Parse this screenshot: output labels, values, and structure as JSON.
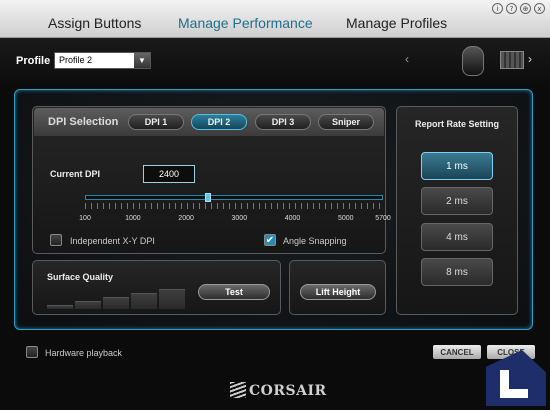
{
  "tabs": {
    "assign": "Assign Buttons",
    "manage_performance": "Manage Performance",
    "manage_profiles": "Manage Profiles"
  },
  "window_controls": [
    "i",
    "?",
    "⊕",
    "x"
  ],
  "profile": {
    "label": "Profile",
    "selected": "Profile 2"
  },
  "dpi": {
    "title": "DPI Selection",
    "buttons": [
      "DPI 1",
      "DPI 2",
      "DPI 3",
      "Sniper"
    ],
    "active_index": 1,
    "current_label": "Current DPI",
    "current_value": "2400",
    "slider_min": 100,
    "slider_max": 5700,
    "tick_labels": [
      "100",
      "1000",
      "2000",
      "3000",
      "4000",
      "5000",
      "5700"
    ],
    "independent_xy": {
      "label": "Independent X-Y DPI",
      "checked": false
    },
    "angle_snapping": {
      "label": "Angle Snapping",
      "checked": true
    }
  },
  "surface": {
    "title": "Surface Quality",
    "test_label": "Test",
    "level": 0
  },
  "lift": {
    "label": "Lift Height"
  },
  "report_rate": {
    "title": "Report Rate Setting",
    "options": [
      "1 ms",
      "2 ms",
      "4 ms",
      "8 ms"
    ],
    "active_index": 0
  },
  "hardware_playback": {
    "label": "Hardware playback",
    "checked": false
  },
  "footer": {
    "cancel": "CANCEL",
    "close": "CLOSE",
    "brand": "CORSAIR"
  },
  "colors": {
    "accent": "#2d9fc6",
    "active_tab": "#1f6f8a"
  }
}
